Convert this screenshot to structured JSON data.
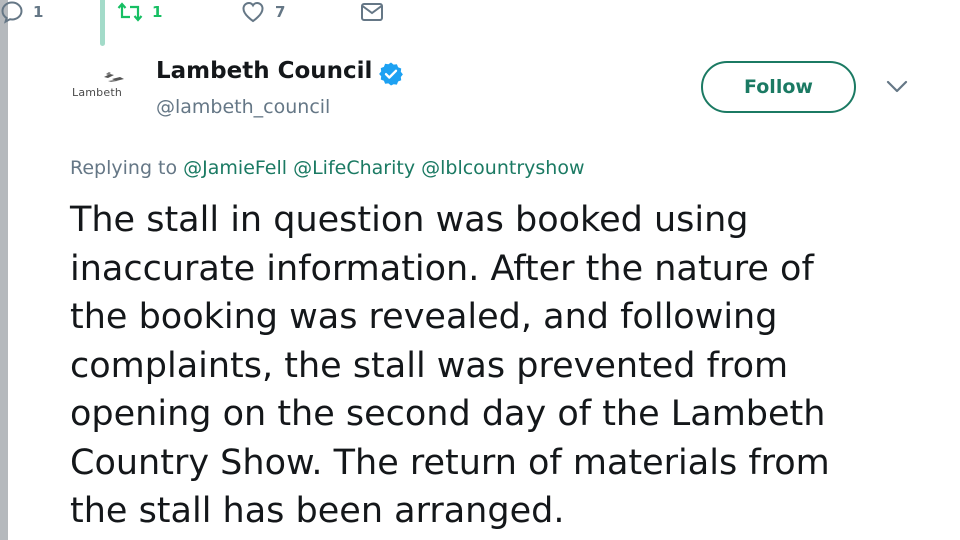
{
  "actions": {
    "reply_count": "1",
    "retweet_count": "1",
    "like_count": "7"
  },
  "author": {
    "avatar_label": "Lambeth",
    "display_name": "Lambeth Council",
    "handle": "@lambeth_council",
    "verified": true
  },
  "follow_label": "Follow",
  "replying": {
    "prefix": "Replying to ",
    "mentions": [
      "@JamieFell",
      "@LifeCharity",
      "@lblcountryshow"
    ]
  },
  "tweet": {
    "lines": [
      "The stall in question was booked using",
      "inaccurate information. After the nature of",
      "the booking was revealed, and following",
      "complaints, the stall was prevented from",
      "opening on the second day of the Lambeth",
      "Country Show. The return of materials from",
      "the stall has been arranged."
    ]
  },
  "colors": {
    "accent": "#1b7a63",
    "retweet_active": "#17bf63",
    "muted": "#657786",
    "verified": "#1da1f2"
  }
}
